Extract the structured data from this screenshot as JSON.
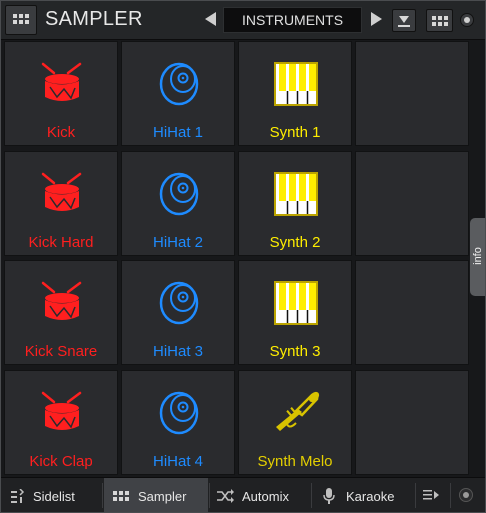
{
  "header": {
    "title": "SAMPLER",
    "bank": "INSTRUMENTS",
    "icons": [
      "grid-menu-icon",
      "arrow-left-icon",
      "arrow-right-icon",
      "download-icon",
      "grid-view-icon",
      "dot-icon"
    ]
  },
  "colors": {
    "red": "#ff1f1f",
    "blue": "#1e8bff",
    "yellow": "#ffee00",
    "gold": "#e4cf00"
  },
  "pads": [
    {
      "label": "Kick",
      "icon": "drum-icon",
      "color": "red"
    },
    {
      "label": "HiHat 1",
      "icon": "cymbal-icon",
      "color": "blue"
    },
    {
      "label": "Synth 1",
      "icon": "piano-keys-icon",
      "color": "yellow"
    },
    {
      "label": "",
      "icon": "",
      "color": ""
    },
    {
      "label": "Kick Hard",
      "icon": "drum-icon",
      "color": "red"
    },
    {
      "label": "HiHat 2",
      "icon": "cymbal-icon",
      "color": "blue"
    },
    {
      "label": "Synth 2",
      "icon": "piano-keys-icon",
      "color": "yellow"
    },
    {
      "label": "",
      "icon": "",
      "color": ""
    },
    {
      "label": "Kick Snare",
      "icon": "drum-icon",
      "color": "red"
    },
    {
      "label": "HiHat 3",
      "icon": "cymbal-icon",
      "color": "blue"
    },
    {
      "label": "Synth 3",
      "icon": "piano-keys-icon",
      "color": "yellow"
    },
    {
      "label": "",
      "icon": "",
      "color": ""
    },
    {
      "label": "Kick Clap",
      "icon": "drum-icon",
      "color": "red"
    },
    {
      "label": "HiHat 4",
      "icon": "cymbal-icon",
      "color": "blue"
    },
    {
      "label": "Synth Melo",
      "icon": "trumpet-icon",
      "color": "gold"
    },
    {
      "label": "",
      "icon": "",
      "color": ""
    }
  ],
  "info_tab": "info",
  "bottom_tabs": [
    {
      "label": "Sidelist",
      "icon": "sidelist-icon",
      "active": false
    },
    {
      "label": "Sampler",
      "icon": "grid-icon",
      "active": true
    },
    {
      "label": "Automix",
      "icon": "shuffle-icon",
      "active": false
    },
    {
      "label": "Karaoke",
      "icon": "microphone-icon",
      "active": false
    }
  ]
}
